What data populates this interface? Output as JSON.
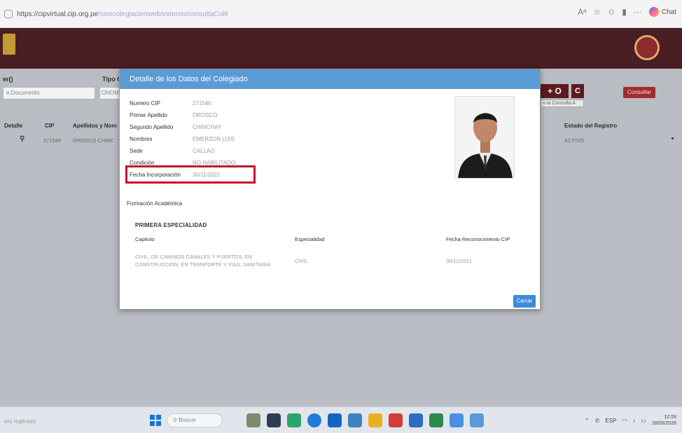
{
  "browser": {
    "url_host": "https://cipvirtual.cip.org.pe",
    "url_path": "/sicecolegiacionweb/externo/consultaCol#"
  },
  "filters": {
    "label1": "er()",
    "select1_value": "e Documento",
    "label2": "Tipo Co",
    "select2_value": "ONOM",
    "button_o": "+ O",
    "button_c": "C",
    "hint": "n la Consulta A",
    "consultar": "Consultar"
  },
  "grid": {
    "headers": [
      "Detalle",
      "CIP",
      "Apellidos y Nom",
      "Estado del Registro"
    ],
    "row": {
      "cip": "271546",
      "name": "OROSCO CHINC",
      "estado": "ACTIVO"
    }
  },
  "modal": {
    "title": "Detalle de los Datos del Colegiado",
    "details": [
      {
        "label": "Numero CIP",
        "value": "271546"
      },
      {
        "label": "Primer Apellido",
        "value": "OROSCO"
      },
      {
        "label": "Segundo Apellido",
        "value": "CHINCHAY"
      },
      {
        "label": "Nombres",
        "value": "EMERZON LUIS"
      },
      {
        "label": "Sede",
        "value": "CALLAO"
      },
      {
        "label": "Condición",
        "value": "NO HABILITADO"
      },
      {
        "label": "Fecha Incorporación",
        "value": "30/11/2021"
      }
    ],
    "section_heading": "Formación Académica",
    "subsection": "PRIMERA ESPECIALIDAD",
    "table": {
      "headers": [
        "Capitulo",
        "Especialidad",
        "Fecha Reconocimiento CIP"
      ],
      "row": {
        "capitulo_line1": "CIVIL, DE CAMINOS CANALES Y PUERTOS, EN",
        "capitulo_line2": "CONSTRUCCION, EN TRANPORTE Y VIAS, SANITARIA",
        "especialidad": "CIVIL",
        "fecha": "30/11/2021"
      }
    },
    "close_label": "Cerrar"
  },
  "taskbar": {
    "status": "ers regitrado",
    "search_placeholder": "Buscar",
    "lang": "ESP",
    "time": "12:59",
    "date": "28/05/2026"
  },
  "colors": {
    "header_maroon": "#4a1e22",
    "modal_header": "#5b9bd5",
    "highlight": "#c4142e",
    "close_button": "#3d8ad8"
  }
}
